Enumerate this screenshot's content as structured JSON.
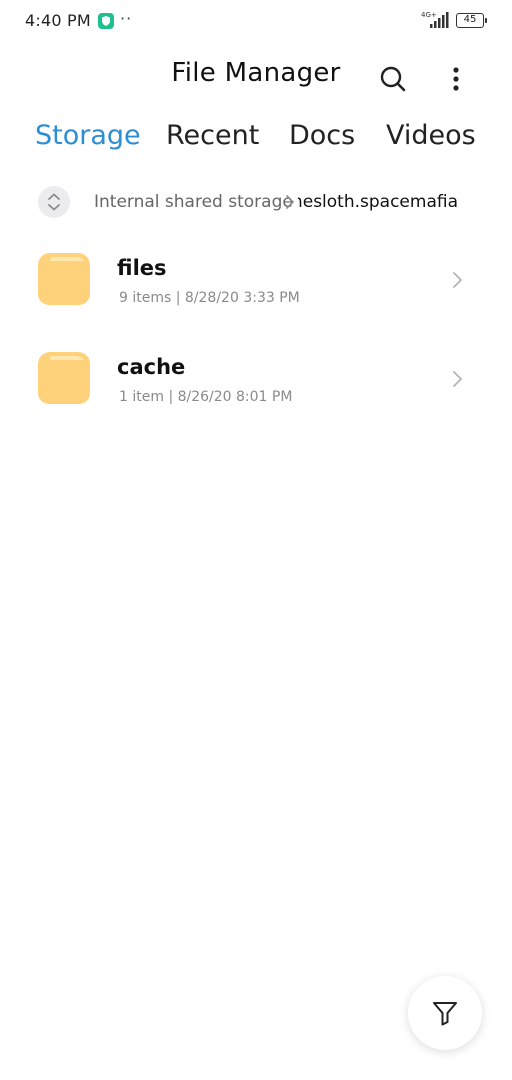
{
  "status_bar": {
    "time": "4:40 PM",
    "dots": "··",
    "network": "4G+",
    "battery": "45"
  },
  "header": {
    "title": "File Manager"
  },
  "tabs": [
    {
      "label": "Storage",
      "active": true
    },
    {
      "label": "Recent",
      "active": false
    },
    {
      "label": "Docs",
      "active": false
    },
    {
      "label": "Videos",
      "active": false
    }
  ],
  "breadcrumb": {
    "root": "Internal shared storage",
    "current": "com.gamesloth.spacemafia"
  },
  "files": [
    {
      "name": "files",
      "meta": "9 items  |  8/28/20 3:33 PM"
    },
    {
      "name": "cache",
      "meta": "1 item  |  8/26/20 8:01 PM"
    }
  ],
  "icons": {
    "app_notification": "shield-icon",
    "search": "search-icon",
    "more": "more-vertical-icon",
    "folder": "folder-icon",
    "chevron": "chevron-right-icon",
    "filter": "filter-icon"
  },
  "colors": {
    "accent": "#2d8ed4",
    "folder": "#fdd27a",
    "app_icon": "#1fbf8f"
  }
}
